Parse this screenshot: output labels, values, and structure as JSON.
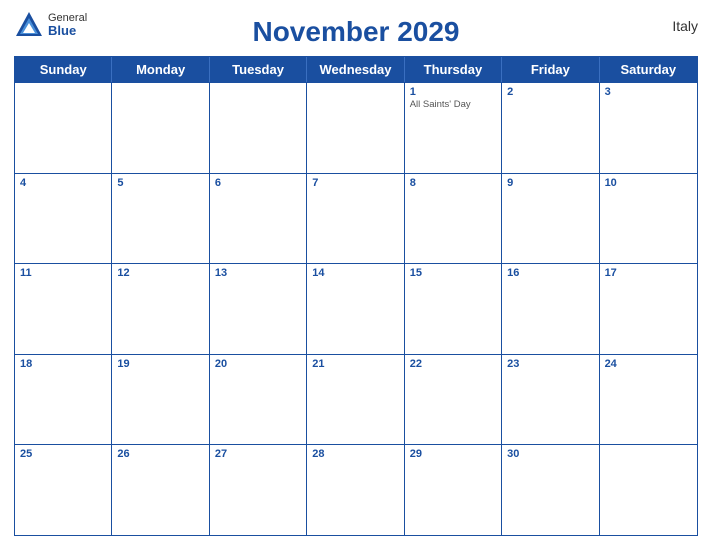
{
  "header": {
    "title": "November 2029",
    "country": "Italy",
    "logo": {
      "general": "General",
      "blue": "Blue"
    }
  },
  "days_of_week": [
    "Sunday",
    "Monday",
    "Tuesday",
    "Wednesday",
    "Thursday",
    "Friday",
    "Saturday"
  ],
  "weeks": [
    [
      {
        "date": null
      },
      {
        "date": null
      },
      {
        "date": null
      },
      {
        "date": null
      },
      {
        "date": "1",
        "holiday": "All Saints' Day"
      },
      {
        "date": "2"
      },
      {
        "date": "3"
      }
    ],
    [
      {
        "date": "4"
      },
      {
        "date": "5"
      },
      {
        "date": "6"
      },
      {
        "date": "7"
      },
      {
        "date": "8"
      },
      {
        "date": "9"
      },
      {
        "date": "10"
      }
    ],
    [
      {
        "date": "11"
      },
      {
        "date": "12"
      },
      {
        "date": "13"
      },
      {
        "date": "14"
      },
      {
        "date": "15"
      },
      {
        "date": "16"
      },
      {
        "date": "17"
      }
    ],
    [
      {
        "date": "18"
      },
      {
        "date": "19"
      },
      {
        "date": "20"
      },
      {
        "date": "21"
      },
      {
        "date": "22"
      },
      {
        "date": "23"
      },
      {
        "date": "24"
      }
    ],
    [
      {
        "date": "25"
      },
      {
        "date": "26"
      },
      {
        "date": "27"
      },
      {
        "date": "28"
      },
      {
        "date": "29"
      },
      {
        "date": "30"
      },
      {
        "date": null
      }
    ]
  ],
  "colors": {
    "header_bg": "#1a4fa0",
    "header_text": "#ffffff",
    "title_color": "#1a4fa0",
    "border_color": "#1a4fa0"
  }
}
